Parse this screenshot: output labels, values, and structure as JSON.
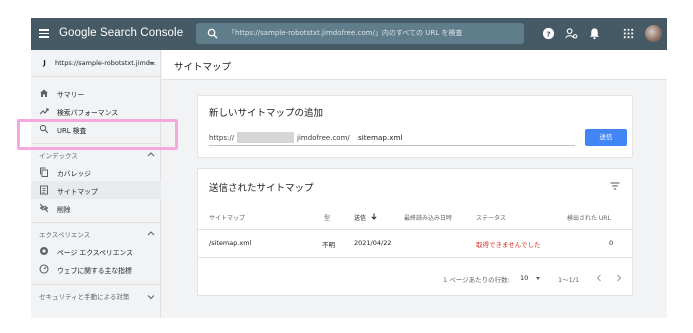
{
  "topbar": {
    "title": "Google Search Console",
    "search_placeholder": "「https://sample-robotstxt.jimdofree.com/」内のすべての URL を検査",
    "icons": [
      "help-icon",
      "account-settings-icon",
      "bell-icon",
      "apps-icon"
    ]
  },
  "sidebar": {
    "property_badge": "J",
    "property": "https://sample-robotstxt.jimd...",
    "items_top": [
      {
        "label": "サマリー",
        "icon": "home-icon"
      },
      {
        "label": "検索パフォーマンス",
        "icon": "trending-icon"
      },
      {
        "label": "URL 検査",
        "icon": "search-icon"
      }
    ],
    "section_index": "インデックス",
    "items_index": [
      {
        "label": "カバレッジ",
        "icon": "copy-icon"
      },
      {
        "label": "サイトマップ",
        "icon": "sitemap-icon",
        "active": true
      },
      {
        "label": "削除",
        "icon": "eye-off-icon"
      }
    ],
    "section_experience": "エクスペリエンス",
    "items_experience": [
      {
        "label": "ページ エクスペリエンス",
        "icon": "star-circle-icon"
      },
      {
        "label": "ウェブに関する主な指標",
        "icon": "gauge-icon"
      }
    ],
    "section_security": "セキュリティと手動による対策"
  },
  "main": {
    "page_title": "サイトマップ",
    "add_card": {
      "title": "新しいサイトマップの追加",
      "prefix": "https://",
      "domain": "jimdofree.com/",
      "input_value": "sitemap.xml",
      "submit_label": "送信"
    },
    "submitted_card": {
      "title": "送信されたサイトマップ",
      "columns": [
        "サイトマップ",
        "型",
        "送信",
        "最終読み込み日時",
        "ステータス",
        "検出された URL"
      ],
      "rows": [
        {
          "sitemap": "/sitemap.xml",
          "type": "不明",
          "submitted": "2021/04/22",
          "last_read": "",
          "status": "取得できませんでした",
          "urls": "0"
        }
      ],
      "pager": {
        "rows_label": "1 ページあたりの行数:",
        "rows_value": "10",
        "range": "1〜1/1"
      }
    }
  },
  "colors": {
    "topbar": "#455a64",
    "accent": "#4285f4",
    "error": "#d93025",
    "highlight": "#f7a8e0"
  }
}
